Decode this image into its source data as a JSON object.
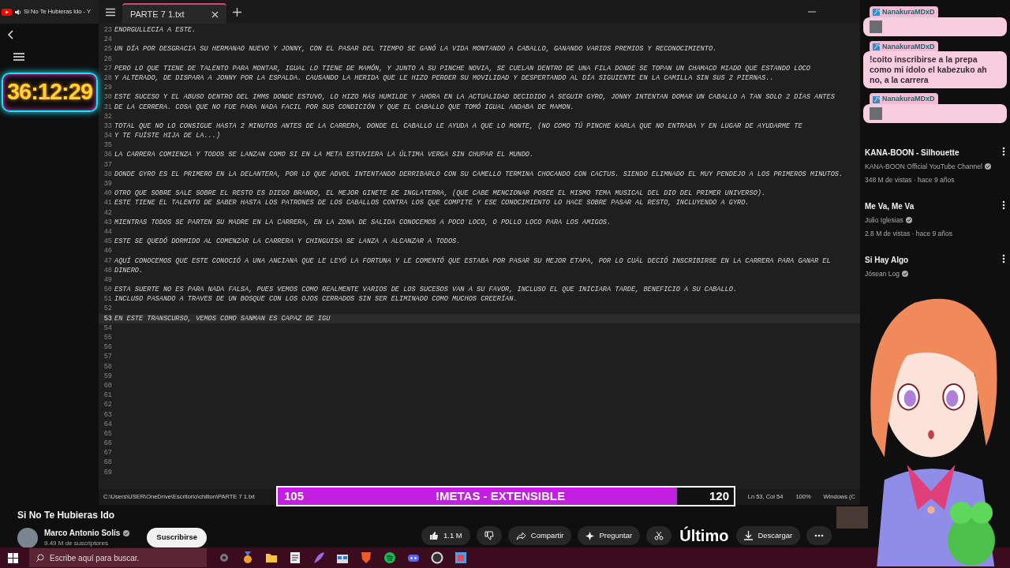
{
  "browser_tab": {
    "title": "Si No Te Hubieras Ido - Y"
  },
  "timer": "36:12:29",
  "editor": {
    "tab": {
      "title": "PARTE 7 1.txt",
      "selected": true
    },
    "lines": [
      {
        "number": "23",
        "text": "ENORGULLECIA A ESTE.",
        "selected": false
      },
      {
        "number": "24",
        "selected": false
      },
      {
        "number": "25",
        "text": "UN DÍA POR DESGRACIA SU HERMANAO NUEVO Y JONNY, CON EL PASAR DEL TIEMPO SE GANÓ LA VIDA MONTANDO A CABALLO, GANANDO VARIOS PREMIOS Y RECONOCIMIENTO.",
        "selected": false
      },
      {
        "number": "26",
        "selected": false
      },
      {
        "number": "27",
        "text": "PERO LO QUE TIENE DE TALENTO PARA MONTAR, IGUAL LO TIENE DE MAMÓN, Y JUNTO A SU PINCHE NOVIA, SE CUELAN DENTRO DE UNA FILA DONDE SE TOPAN UN CHAMACO MIADO QUE ESTANDO LOCO",
        "selected": false
      },
      {
        "number": "28",
        "text": "Y ALTERADO, DE DISPARA A JONNY POR LA ESPALDA. CAUSANDO LA HERIDA QUE LE HIZO PERDER SU MOVILIDAD Y DESPERTANDO AL DÍA SIGUIENTE EN LA CAMILLA SIN SUS 2 PIERNAS..",
        "selected": false
      },
      {
        "number": "29",
        "selected": false
      },
      {
        "number": "30",
        "text": "ESTE SUCESO Y EL ABUSO DENTRO DEL IMMS DONDE ESTUVO, LO HIZO MÁS HUMILDE Y AHORA EN LA ACTUALIDAD DECIDIDO A SEGUIR GYRO, JONNY INTENTAN DOMAR UN CABALLO A TAN SOLO 2 DÍAS ANTES",
        "selected": false
      },
      {
        "number": "31",
        "text": "DE LA CERRERA. COSA QUE NO FUE PARA NADA FACIL POR SUS CONDICIÓN Y QUE EL CABALLO QUE TOMÓ IGUAL ANDABA DE MAMON.",
        "selected": false
      },
      {
        "number": "32",
        "selected": false
      },
      {
        "number": "33",
        "text": "TOTAL QUE NO LO CONSIGUE HASTA 2 MINUTOS ANTES DE LA CARRERA, DONDE EL CABALLO LE AYUDA A QUE LO MONTE, (NO COMO TÚ PINCHE KARLA QUE NO ENTRABA Y EN LUGAR DE AYUDARME TE",
        "selected": false
      },
      {
        "number": "34",
        "text": "Y TE FUÍSTE HIJA DE LA...)",
        "selected": false
      },
      {
        "number": "35",
        "selected": false
      },
      {
        "number": "36",
        "text": "LA CARRERA COMIENZA Y TODOS SE LANZAN COMO SI EN LA META ESTUVIERA LA ÚLTIMA VERGA SIN CHUPAR EL MUNDO.",
        "selected": false
      },
      {
        "number": "37",
        "selected": false
      },
      {
        "number": "38",
        "text": "DONDE GYRO ES EL PRIMERO EN LA DELANTERA, POR LO QUE ADVOL INTENTANDO DERRIBARLO CON SU CAMELLO TERMINA CHOCANDO CON CACTUS. SIENDO ELIMNADO EL MUY PENDEJO A LOS PRIMEROS MINUTOS.",
        "selected": false
      },
      {
        "number": "39",
        "selected": false
      },
      {
        "number": "40",
        "text": "OTRO QUE SOBRE SALE SOBRE EL RESTO ES DIEGO BRANDO, EL MEJOR GINETE DE INGLATERRA, (QUE CABE MENCIONAR POSEE EL MISMO TEMA MUSICAL DEL DIO DEL PRIMER UNIVERSO).",
        "selected": false
      },
      {
        "number": "41",
        "text": "ESTE TIENE EL TALENTO DE SABER HASTA LOS PATRONES DE LOS CABALLOS CONTRA LOS QUE COMPITE Y ESE CONOCIMIENTO LO HACE SOBRE PASAR AL RESTO, INCLUYENDO A GYRO.",
        "selected": false
      },
      {
        "number": "42",
        "selected": false
      },
      {
        "number": "43",
        "text": "MIENTRAS TODOS SE PARTEN SU MADRE EN LA CARRERA, EN LA ZONA DE SALIDA CONOCEMOS A POCO LOCO, O POLLO LOCO PARA LOS AMIGOS.",
        "selected": false
      },
      {
        "number": "44",
        "selected": false
      },
      {
        "number": "45",
        "text": "ESTE SE QUEDÓ DORMIDO AL COMENZAR LA CARRERA Y CHINGUISA SE LANZA A ALCANZAR A TODOS.",
        "selected": false
      },
      {
        "number": "46",
        "selected": false
      },
      {
        "number": "47",
        "text": "AQUÍ CONOCEMOS QUE ESTE CONOCIÓ A UNA ANCIANA QUE LE LEYÓ LA FORTUNA Y LE COMENTÓ QUE ESTABA POR PASAR SU MEJOR ETAPA, POR LO CUÁL DECIÓ INSCRIBIRSE EN LA CARRERA PARA GANAR EL",
        "selected": false
      },
      {
        "number": "48",
        "text": "DINERO.",
        "selected": false
      },
      {
        "number": "49",
        "selected": false
      },
      {
        "number": "50",
        "text": "ESTA SUERTE NO ES PARA NADA FALSA, PUES VEMOS COMO REALMENTE VARIOS DE LOS SUCESOS VAN A SU FAVOR, INCLUSO EL QUE INICIARA TARDE, BENEFICIO A SU CABALLO.",
        "selected": false
      },
      {
        "number": "51",
        "text": "INCLUSO PASANDO A TRAVES DE UN BOSQUE CON LOS OJOS CERRADOS SIN SER ELIMINADO COMO MUCHOS CREERÍAN.",
        "selected": false
      },
      {
        "number": "52",
        "selected": false
      },
      {
        "number": "53",
        "text": "EN ESTE TRANSCURSO, VEMOS COMO SANMAN ES CAPAZ DE IGU",
        "selected": true
      },
      {
        "number": "54",
        "selected": false
      },
      {
        "number": "55",
        "selected": false
      },
      {
        "number": "56",
        "selected": false
      },
      {
        "number": "57",
        "selected": false
      },
      {
        "number": "58",
        "selected": false
      },
      {
        "number": "59",
        "selected": false
      },
      {
        "number": "60",
        "selected": false
      },
      {
        "number": "61",
        "selected": false
      },
      {
        "number": "62",
        "selected": false
      },
      {
        "number": "63",
        "selected": false
      },
      {
        "number": "64",
        "selected": false
      },
      {
        "number": "65",
        "selected": false
      },
      {
        "number": "66",
        "selected": false
      },
      {
        "number": "67",
        "selected": false
      },
      {
        "number": "68",
        "selected": false
      },
      {
        "number": "69",
        "selected": false
      }
    ],
    "status_bar": {
      "path": "C:\\Users\\USER\\OneDrive\\Escritorio\\chilton\\PARTE 7 1.txt",
      "position": "Ln 53, Col 54",
      "zoom": "100%",
      "line_ending": "Windows (C"
    }
  },
  "chat": [
    {
      "kind": "emote",
      "user": "NanakuraMDxD"
    },
    {
      "kind": "text",
      "user": "NanakuraMDxD",
      "message": "!coito inscribirse a la prepa como mi ídolo el kabezuko ah no, a la carrera"
    },
    {
      "kind": "emote",
      "user": "NanakuraMDxD"
    }
  ],
  "recommendations": [
    {
      "title": "KANA-BOON - Silhouette",
      "channel": "KANA-BOON Official YouTube Channel",
      "stats": "348 M de vistas · hace 9 años"
    },
    {
      "title": "Me Va, Me Va",
      "channel": "Julio Iglesias",
      "stats": "2.8 M de vistas · hace 9 años"
    },
    {
      "title": "Si Hay Algo",
      "channel": "Jósean Log"
    }
  ],
  "goal_bar": {
    "current": "105",
    "label": "!METAS - EXTENSIBLE",
    "target": "120",
    "level": 0.875
  },
  "video": {
    "title": "Si No Te Hubieras Ido",
    "channel": "Marco Antonio Solís",
    "subscribers": "9.49 M de suscriptores",
    "subscribe": "Suscribirse",
    "likes": "1.1 M",
    "share": "Compartir",
    "ask": "Preguntar",
    "download": "Descargar"
  },
  "overlay_text": "Último",
  "taskbar": {
    "search_placeholder": "Escribe aquí para buscar."
  }
}
